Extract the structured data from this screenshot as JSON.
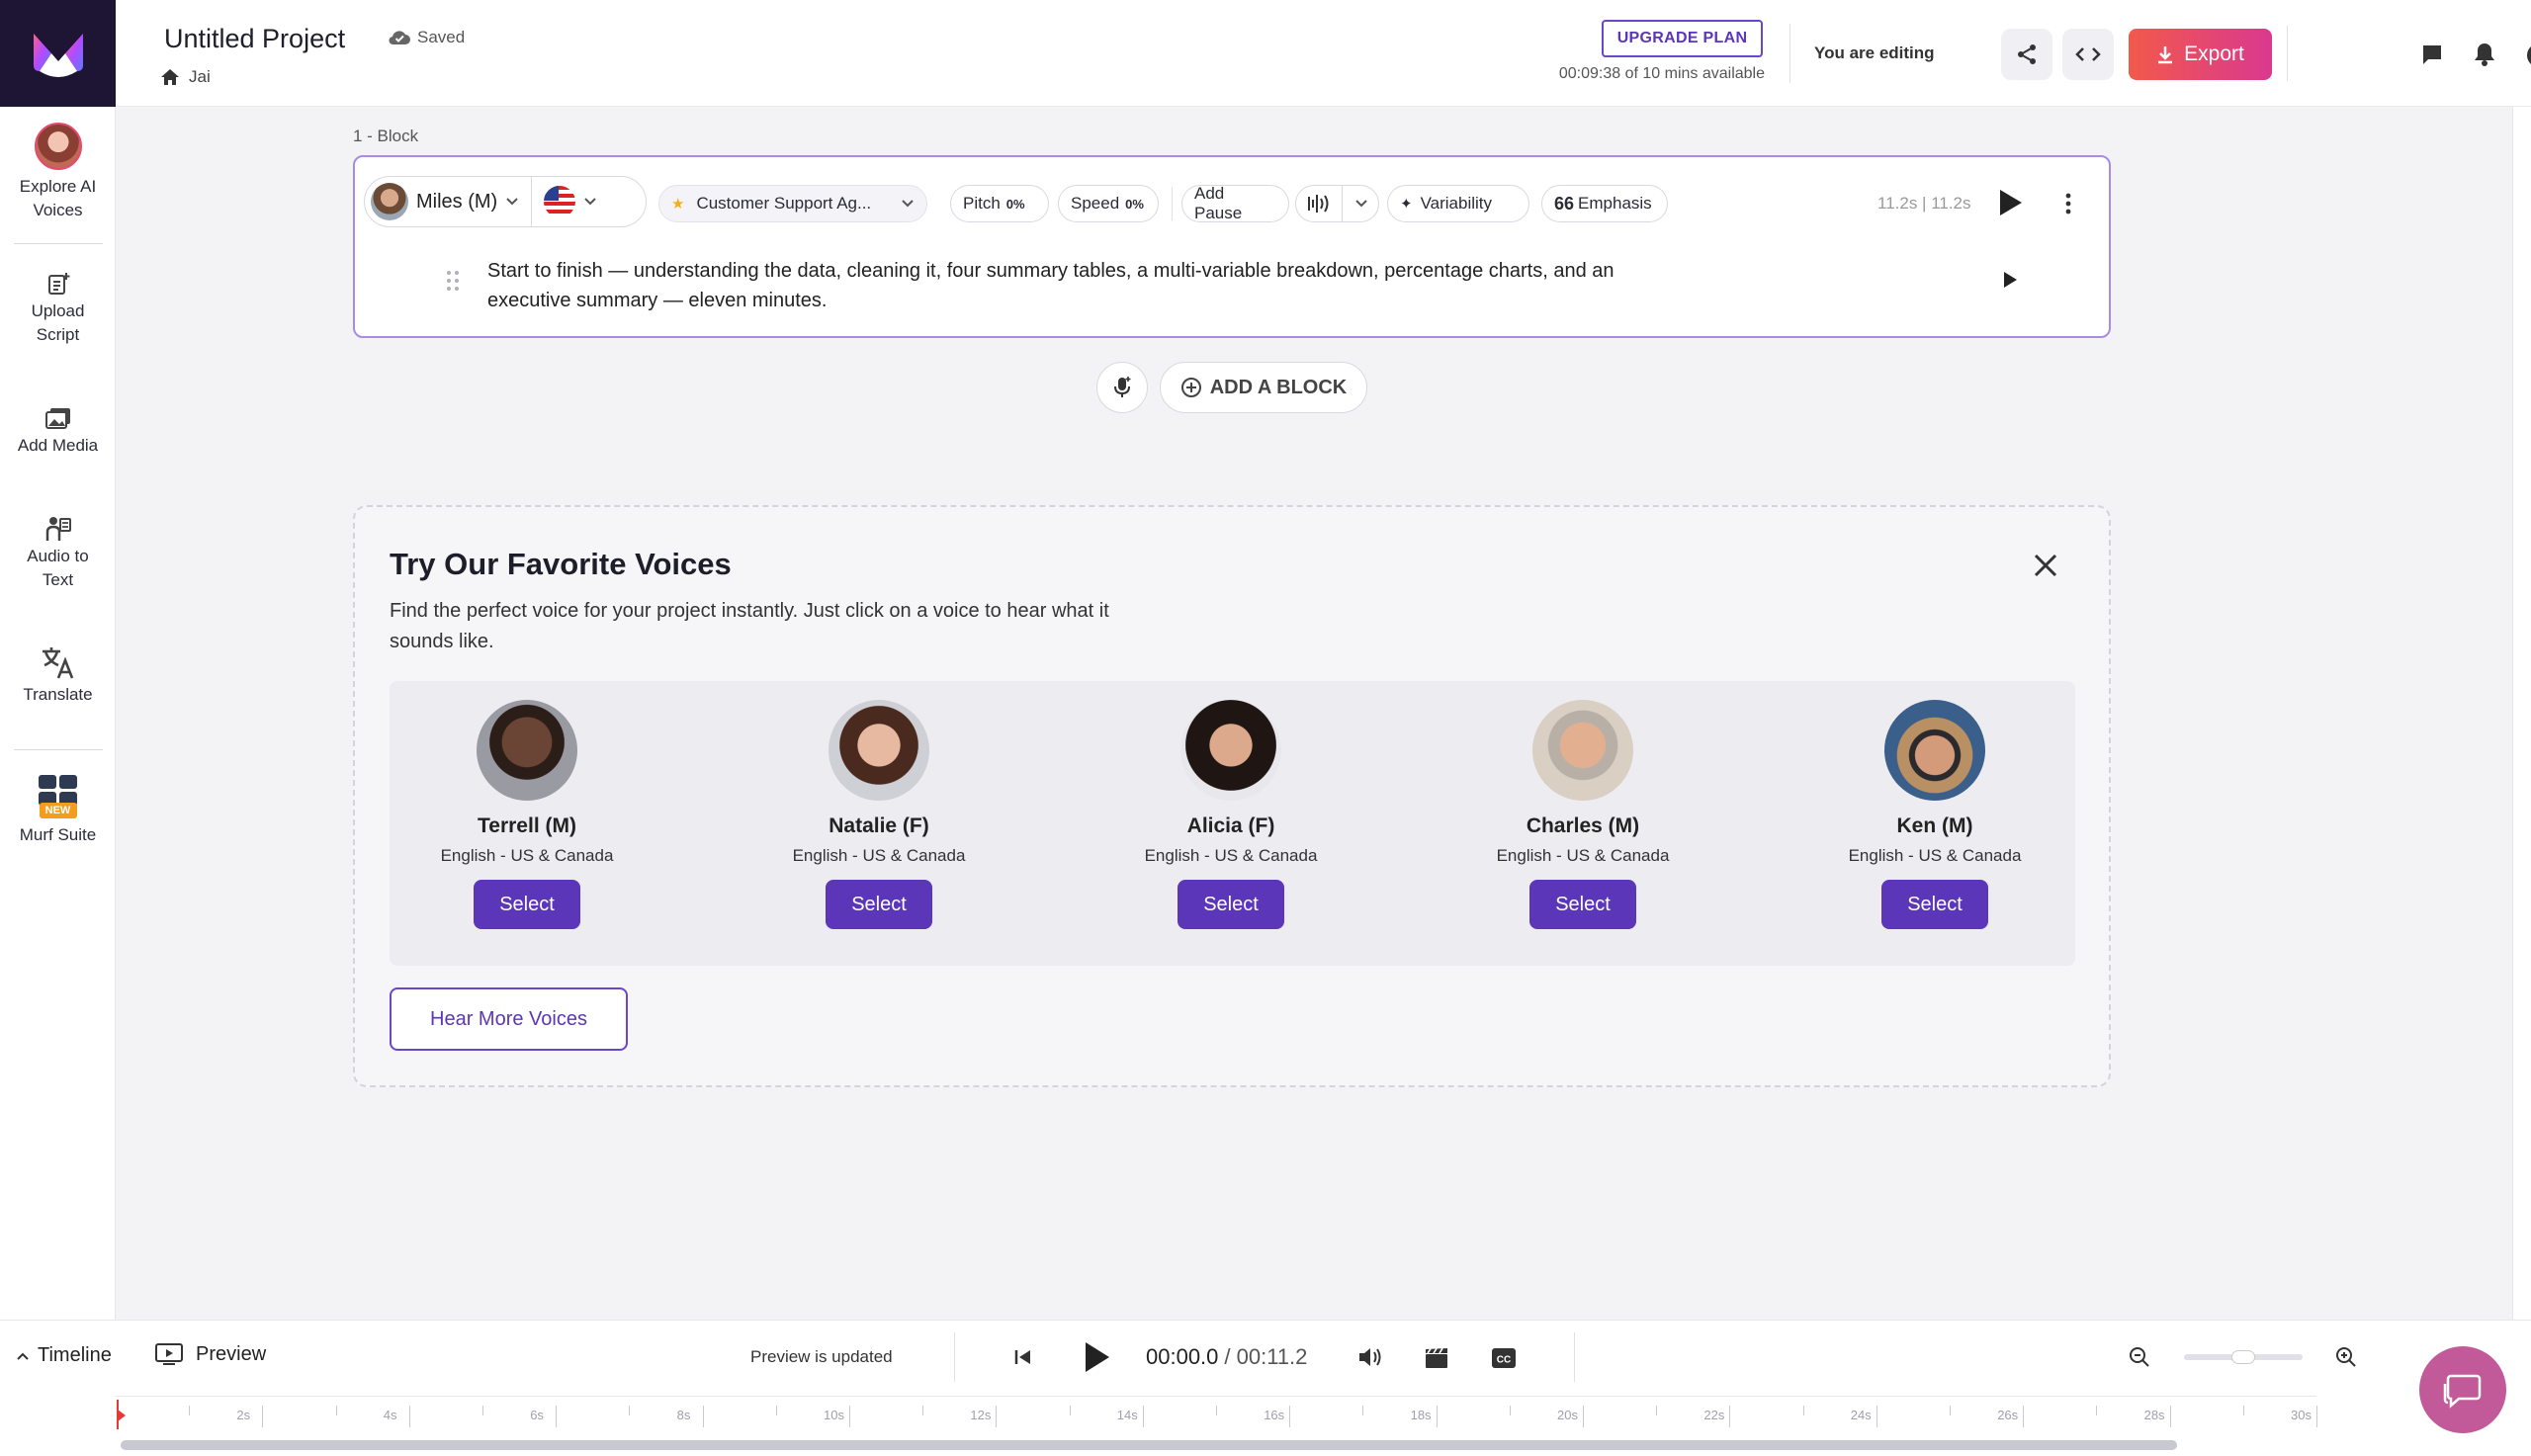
{
  "header": {
    "project_title": "Untitled Project",
    "saved_label": "Saved",
    "breadcrumb_home": "Jai",
    "upgrade_label": "UPGRADE PLAN",
    "usage_text": "00:09:38 of 10 mins available",
    "editing_status": "You are editing",
    "export_label": "Export"
  },
  "sidebar": {
    "items": [
      {
        "label1": "Explore AI",
        "label2": "Voices"
      },
      {
        "label1": "Upload",
        "label2": "Script"
      },
      {
        "label1": "Add Media",
        "label2": ""
      },
      {
        "label1": "Audio to",
        "label2": "Text"
      },
      {
        "label1": "Translate",
        "label2": ""
      },
      {
        "label1": "Murf Suite",
        "label2": "",
        "badge": "NEW"
      }
    ]
  },
  "block": {
    "label": "1 -  Block",
    "voice": "Miles (M)",
    "style": "Customer Support Ag...",
    "pitch_label": "Pitch",
    "pitch_value": "0%",
    "speed_label": "Speed",
    "speed_value": "0%",
    "add_pause": "Add Pause",
    "variability": "Variability",
    "emphasis": "Emphasis",
    "duration": "11.2s | 11.2s",
    "text_line1": "Start to finish — understanding the data, cleaning it, four summary tables, a multi-variable breakdown, percentage charts, and an",
    "text_line2": "executive summary — eleven minutes."
  },
  "add_block_label": "ADD A BLOCK",
  "favorites": {
    "title": "Try Our Favorite Voices",
    "desc_line1": "Find the perfect voice for your project instantly. Just click on a voice to hear what it",
    "desc_line2": "sounds like.",
    "voices": [
      {
        "name": "Terrell (M)",
        "lang": "English - US & Canada",
        "select": "Select"
      },
      {
        "name": "Natalie (F)",
        "lang": "English - US & Canada",
        "select": "Select"
      },
      {
        "name": "Alicia (F)",
        "lang": "English - US & Canada",
        "select": "Select"
      },
      {
        "name": "Charles (M)",
        "lang": "English - US & Canada",
        "select": "Select"
      },
      {
        "name": "Ken (M)",
        "lang": "English - US & Canada",
        "select": "Select"
      }
    ],
    "hear_more": "Hear More Voices"
  },
  "bottom": {
    "timeline_label": "Timeline",
    "preview_label": "Preview",
    "preview_status": "Preview is updated",
    "current_time": "00:00.0",
    "total_time": "/ 00:11.2",
    "ticks": [
      "2s",
      "4s",
      "6s",
      "8s",
      "10s",
      "12s",
      "14s",
      "16s",
      "18s",
      "20s",
      "22s",
      "24s",
      "26s",
      "28s",
      "30s"
    ]
  },
  "colors": {
    "accent": "#5b36b8",
    "export_start": "#f2594b",
    "export_end": "#d9398f",
    "playhead": "#e53935"
  }
}
